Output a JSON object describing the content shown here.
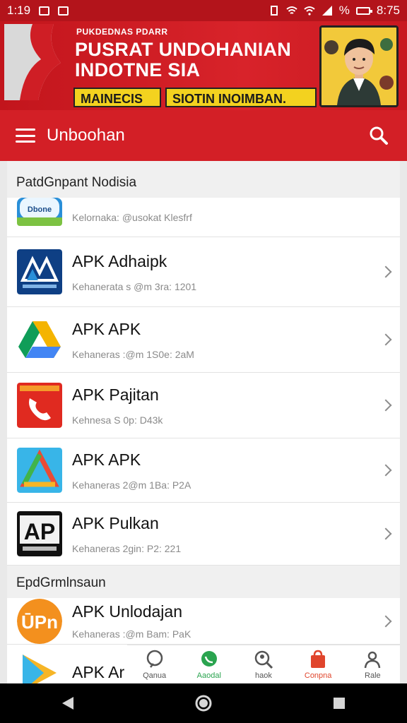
{
  "status_bar": {
    "time_left": "1:19",
    "time_right": "8:75",
    "battery": "%"
  },
  "banner": {
    "small_text": "PUKDEDNAS PDARR",
    "title_line1": "PUSRAT UNDOHANIAN",
    "title_line2": "INDOTNE SIA",
    "pill1": "MAINECIS",
    "pill2": "SIOTIN INOIMBAN."
  },
  "app_bar": {
    "title": "Unboohan"
  },
  "sections": [
    {
      "header": "PatdGnpant Nodisia",
      "items": [
        {
          "title": "",
          "subtitle": "Kelornaka: @usokat Klesfrf",
          "icon": "partial-app-icon"
        },
        {
          "title": "APK Adhaipk",
          "subtitle": "Kehanerata s @m 3ra: 1201",
          "icon": "blue-triangle-app-icon"
        },
        {
          "title": "APK APK",
          "subtitle": "Kehaneras :@m 1S0e: 2aM",
          "icon": "drive-app-icon"
        },
        {
          "title": "APK Pajitan",
          "subtitle": "Kehnesa S 0p: D43k",
          "icon": "phone-app-icon"
        },
        {
          "title": "APK APK",
          "subtitle": "Kehaneras 2@m 1Ba: P2A",
          "icon": "gradient-triangle-app-icon"
        },
        {
          "title": "APK Pulkan",
          "subtitle": "Kehaneras 2gin: P2: 221",
          "icon": "ap-logo-app-icon"
        }
      ]
    },
    {
      "header": "EpdGrmlnsaun",
      "items": [
        {
          "title": "APK Unlodajan",
          "subtitle": "Kehaneras :@m Bam: PaK",
          "icon": "opn-app-icon"
        },
        {
          "title": "APK Ar",
          "subtitle": "",
          "icon": "play-app-icon"
        }
      ]
    }
  ],
  "bottom_nav": [
    {
      "label": "Qanua",
      "icon": "chat-icon",
      "color": "#555555"
    },
    {
      "label": "Aaodal",
      "icon": "whatsapp-icon",
      "color": "#2aa44f"
    },
    {
      "label": "haok",
      "icon": "search-person-icon",
      "color": "#555555"
    },
    {
      "label": "Conpna",
      "icon": "bag-icon",
      "color": "#e0452c"
    },
    {
      "label": "Rale",
      "icon": "people-icon",
      "color": "#555555"
    }
  ],
  "colors": {
    "brand_red": "#d31f26",
    "dark_red": "#b3141b",
    "pill_yellow": "#f3d21f"
  }
}
